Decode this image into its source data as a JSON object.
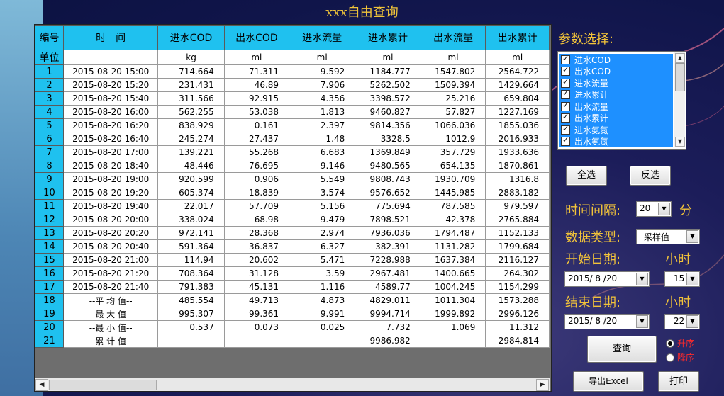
{
  "window": {
    "title": "xxx自由查询"
  },
  "grid": {
    "headers": [
      "编号",
      "时　间",
      "进水COD",
      "出水COD",
      "进水流量",
      "进水累计",
      "出水流量",
      "出水累计"
    ],
    "units_row": [
      "单位",
      "",
      "kg",
      "ml",
      "ml",
      "ml",
      "ml",
      "ml"
    ],
    "rows": [
      [
        "1",
        "2015-08-20 15:00",
        "714.664",
        "71.311",
        "9.592",
        "1184.777",
        "1547.802",
        "2564.722"
      ],
      [
        "2",
        "2015-08-20 15:20",
        "231.431",
        "46.89",
        "7.906",
        "5262.502",
        "1509.394",
        "1429.664"
      ],
      [
        "3",
        "2015-08-20 15:40",
        "311.566",
        "92.915",
        "4.356",
        "3398.572",
        "25.216",
        "659.804"
      ],
      [
        "4",
        "2015-08-20 16:00",
        "562.255",
        "53.038",
        "1.813",
        "9460.827",
        "57.827",
        "1227.169"
      ],
      [
        "5",
        "2015-08-20 16:20",
        "838.929",
        "0.161",
        "2.397",
        "9814.356",
        "1066.036",
        "1855.036"
      ],
      [
        "6",
        "2015-08-20 16:40",
        "245.274",
        "27.437",
        "1.48",
        "3328.5",
        "1012.9",
        "2016.933"
      ],
      [
        "7",
        "2015-08-20 17:00",
        "139.221",
        "55.268",
        "6.683",
        "1369.849",
        "357.729",
        "1933.636"
      ],
      [
        "8",
        "2015-08-20 18:40",
        "48.446",
        "76.695",
        "9.146",
        "9480.565",
        "654.135",
        "1870.861"
      ],
      [
        "9",
        "2015-08-20 19:00",
        "920.599",
        "0.906",
        "5.549",
        "9808.743",
        "1930.709",
        "1316.8"
      ],
      [
        "10",
        "2015-08-20 19:20",
        "605.374",
        "18.839",
        "3.574",
        "9576.652",
        "1445.985",
        "2883.182"
      ],
      [
        "11",
        "2015-08-20 19:40",
        "22.017",
        "57.709",
        "5.156",
        "775.694",
        "787.585",
        "979.597"
      ],
      [
        "12",
        "2015-08-20 20:00",
        "338.024",
        "68.98",
        "9.479",
        "7898.521",
        "42.378",
        "2765.884"
      ],
      [
        "13",
        "2015-08-20 20:20",
        "972.141",
        "28.368",
        "2.974",
        "7936.036",
        "1794.487",
        "1152.133"
      ],
      [
        "14",
        "2015-08-20 20:40",
        "591.364",
        "36.837",
        "6.327",
        "382.391",
        "1131.282",
        "1799.684"
      ],
      [
        "15",
        "2015-08-20 21:00",
        "114.94",
        "20.602",
        "5.471",
        "7228.988",
        "1637.384",
        "2116.127"
      ],
      [
        "16",
        "2015-08-20 21:20",
        "708.364",
        "31.128",
        "3.59",
        "2967.481",
        "1400.665",
        "264.302"
      ],
      [
        "17",
        "2015-08-20 21:40",
        "791.383",
        "45.131",
        "1.116",
        "4589.77",
        "1004.245",
        "1154.299"
      ],
      [
        "18",
        "--平 均 值--",
        "485.554",
        "49.713",
        "4.873",
        "4829.011",
        "1011.304",
        "1573.288"
      ],
      [
        "19",
        "--最 大 值--",
        "995.307",
        "99.361",
        "9.991",
        "9994.714",
        "1999.892",
        "2996.126"
      ],
      [
        "20",
        "--最 小 值--",
        "0.537",
        "0.073",
        "0.025",
        "7.732",
        "1.069",
        "11.312"
      ],
      [
        "21",
        "累 计 值",
        "",
        "",
        "",
        "9986.982",
        "",
        "2984.814"
      ]
    ]
  },
  "params": {
    "label": "参数选择:",
    "items": [
      "进水COD",
      "出水COD",
      "进水流量",
      "进水累计",
      "出水流量",
      "出水累计",
      "进水氨氮",
      "出水氨氮"
    ],
    "select_all": "全选",
    "invert": "反选"
  },
  "interval": {
    "label": "时间间隔:",
    "value": "20",
    "unit": "分"
  },
  "data_type": {
    "label": "数据类型:",
    "value": "采样值"
  },
  "start": {
    "label": "开始日期:",
    "hour_label": "小时",
    "date": "2015/ 8 /20",
    "hour": "15"
  },
  "end": {
    "label": "结束日期:",
    "hour_label": "小时",
    "date": "2015/ 8 /20",
    "hour": "22"
  },
  "actions": {
    "query": "查询",
    "export": "导出Excel",
    "print": "打印"
  },
  "sort": {
    "asc": "升序",
    "desc": "降序",
    "selected": "asc"
  },
  "colors": {
    "accent_label": "#f2c33a",
    "header_bg": "#1fc1ef",
    "selection": "#1e90ff"
  }
}
